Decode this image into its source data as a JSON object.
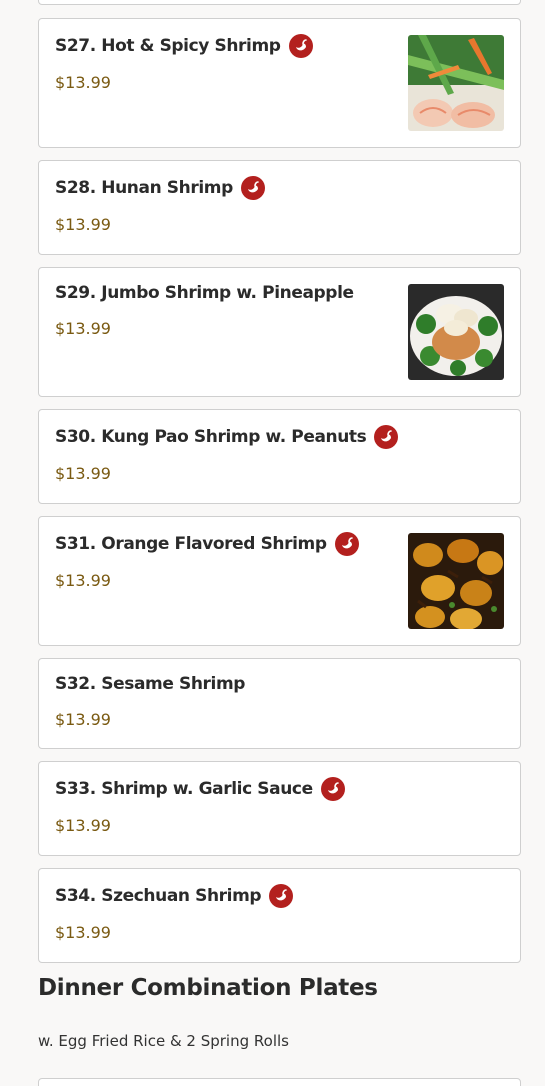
{
  "colors": {
    "background": "#f9f8f7",
    "price": "#7a5a12",
    "spicy_badge": "#b3201e"
  },
  "items": [
    {
      "name": "S27. Hot & Spicy Shrimp",
      "price": "$13.99",
      "spicy": true,
      "image": "shrimp-with-scallions-and-carrots-photo"
    },
    {
      "name": "S28. Hunan Shrimp",
      "price": "$13.99",
      "spicy": true
    },
    {
      "name": "S29. Jumbo Shrimp w. Pineapple",
      "price": "$13.99",
      "spicy": false,
      "image": "shrimp-with-broccoli-and-pineapple-photo"
    },
    {
      "name": "S30. Kung Pao Shrimp w. Peanuts",
      "price": "$13.99",
      "spicy": true
    },
    {
      "name": "S31. Orange Flavored Shrimp",
      "price": "$13.99",
      "spicy": true,
      "image": "orange-glazed-shrimp-photo"
    },
    {
      "name": "S32. Sesame Shrimp",
      "price": "$13.99",
      "spicy": false
    },
    {
      "name": "S33. Shrimp w. Garlic Sauce",
      "price": "$13.99",
      "spicy": true
    },
    {
      "name": "S34. Szechuan Shrimp",
      "price": "$13.99",
      "spicy": true
    }
  ],
  "section": {
    "title": "Dinner Combination Plates",
    "subtitle": "w. Egg Fried Rice & 2 Spring Rolls"
  }
}
